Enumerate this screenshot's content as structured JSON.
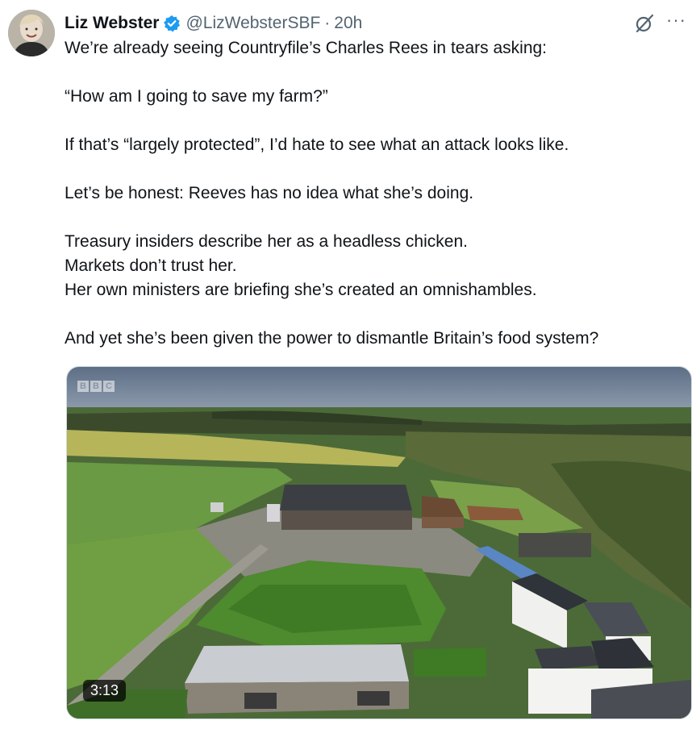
{
  "tweet": {
    "author_name": "Liz Webster",
    "handle": "@LizWebsterSBF",
    "separator": "·",
    "time": "20h",
    "verified_color": "#1d9bf0",
    "lines": [
      "We’re already seeing Countryfile’s Charles Rees in tears asking:",
      "",
      "“How am I going to save my farm?”",
      "",
      "If that’s “largely protected”, I’d hate to see what an attack looks like.",
      "",
      "Let’s be honest: Reeves has no idea what she’s doing.",
      "",
      "Treasury insiders describe her as a headless chicken.",
      "Markets don’t trust her.",
      "Her own ministers are briefing she’s created an omnishambles.",
      "",
      "And yet she’s been given the power to dismantle Britain’s food system?"
    ],
    "more_label": "···"
  },
  "video": {
    "duration": "3:13",
    "watermark": [
      "B",
      "B",
      "C"
    ]
  }
}
